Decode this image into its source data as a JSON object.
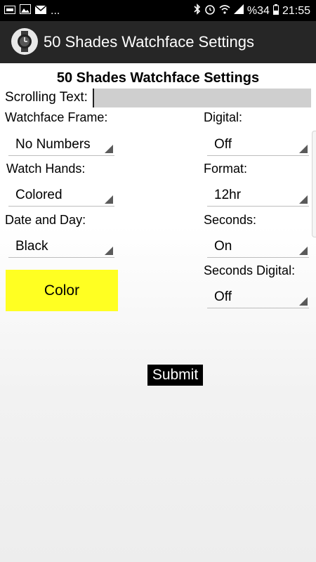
{
  "status_bar": {
    "notifications": [
      "app-notification-icon",
      "gallery-icon",
      "mail-icon"
    ],
    "more": "...",
    "battery": "%34",
    "time": "21:55"
  },
  "appbar": {
    "title": "50 Shades Watchface Settings"
  },
  "page": {
    "heading": "50 Shades Watchface Settings",
    "scrolling_text_label": "Scrolling Text:",
    "scrolling_text_value": "",
    "watchface_frame": {
      "label": "Watchface Frame:",
      "value": "No Numbers"
    },
    "watch_hands": {
      "label": "Watch Hands:",
      "value": "Colored"
    },
    "date_and_day": {
      "label": "Date and Day:",
      "value": "Black"
    },
    "digital": {
      "label": "Digital:",
      "value": "Off"
    },
    "format": {
      "label": "Format:",
      "value": "12hr"
    },
    "seconds": {
      "label": "Seconds:",
      "value": "On"
    },
    "seconds_digital": {
      "label": "Seconds Digital:",
      "value": "Off"
    },
    "color_button": "Color",
    "submit_button": "Submit"
  },
  "colors": {
    "status_bar": "#000000",
    "appbar": "#262626",
    "color_button": "#ffff22",
    "submit_button": "#000000",
    "input_bg": "#cfcfcf"
  }
}
